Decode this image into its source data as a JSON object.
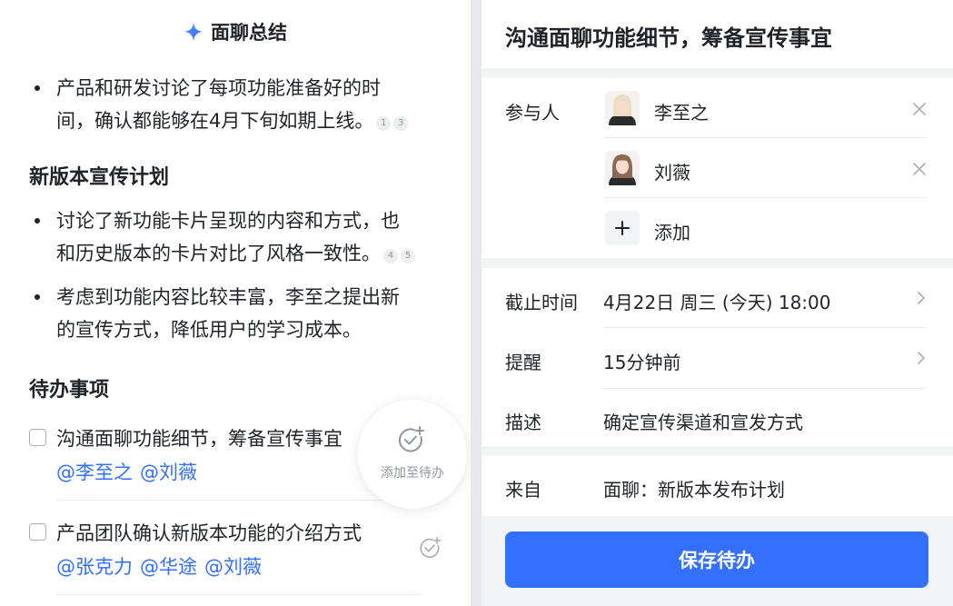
{
  "summary": {
    "title": "面聊总结",
    "points": [
      {
        "line1": "产品和研发讨论了每项功能准备好的时",
        "line2": "间，确认都能够在4月下旬如期上线。",
        "cites": [
          "1",
          "3"
        ]
      }
    ],
    "section": {
      "title": "新版本宣传计划",
      "points": [
        {
          "line1": "讨论了新功能卡片呈现的内容和方式，也",
          "line2": "和历史版本的卡片对比了风格一致性。",
          "cites": [
            "4",
            "5"
          ]
        },
        {
          "line1": "考虑到功能内容比较丰富，李至之提出新",
          "line2": "的宣传方式，降低用户的学习成本。",
          "cites": []
        }
      ]
    }
  },
  "todos": {
    "title": "待办事项",
    "items": [
      {
        "text": "沟通面聊功能细节，筹备宣传事宜",
        "mentions": [
          "@李至之",
          "@刘薇"
        ]
      },
      {
        "text": "产品团队确认新版本功能的介绍方式",
        "mentions": [
          "@张克力",
          "@华途",
          "@刘薇"
        ]
      }
    ],
    "add_label": "添加至待办"
  },
  "detail": {
    "title": "沟通面聊功能细节，筹备宣传事宜",
    "participants_label": "参与人",
    "participants": [
      {
        "name": "李至之"
      },
      {
        "name": "刘薇"
      }
    ],
    "add_label": "添加",
    "deadline_label": "截止时间",
    "deadline_value": "4月22日 周三 (今天) 18:00",
    "reminder_label": "提醒",
    "reminder_value": "15分钟前",
    "desc_label": "描述",
    "desc_value": "确定宣传渠道和宣发方式",
    "from_label": "来自",
    "from_value": "面聊：新版本发布计划",
    "save_label": "保存待办"
  },
  "colors": {
    "accent": "#3370ff",
    "text": "#1f2329",
    "muted": "#8f959e",
    "panel_bg": "#f2f3f5"
  },
  "icons": {
    "sparkle": "sparkle-icon",
    "add_todo": "check-plus-icon",
    "remove": "close-icon",
    "chevron": "chevron-right-icon",
    "add": "plus-icon"
  }
}
